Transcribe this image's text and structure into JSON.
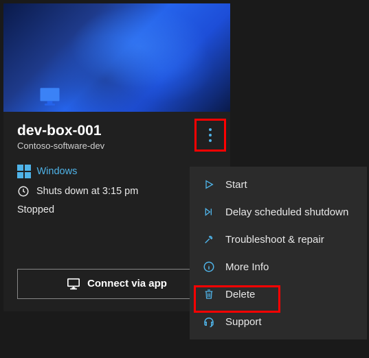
{
  "card": {
    "title": "dev-box-001",
    "subtitle": "Contoso-software-dev",
    "os_label": "Windows",
    "schedule_text": "Shuts down at 3:15 pm",
    "status_text": "Stopped",
    "connect_label": "Connect via app"
  },
  "menu": {
    "items": [
      {
        "label": "Start"
      },
      {
        "label": "Delay scheduled shutdown"
      },
      {
        "label": "Troubleshoot & repair"
      },
      {
        "label": "More Info"
      },
      {
        "label": "Delete"
      },
      {
        "label": "Support"
      }
    ]
  },
  "colors": {
    "accent": "#4fb3e8",
    "highlight": "#ff0000"
  }
}
